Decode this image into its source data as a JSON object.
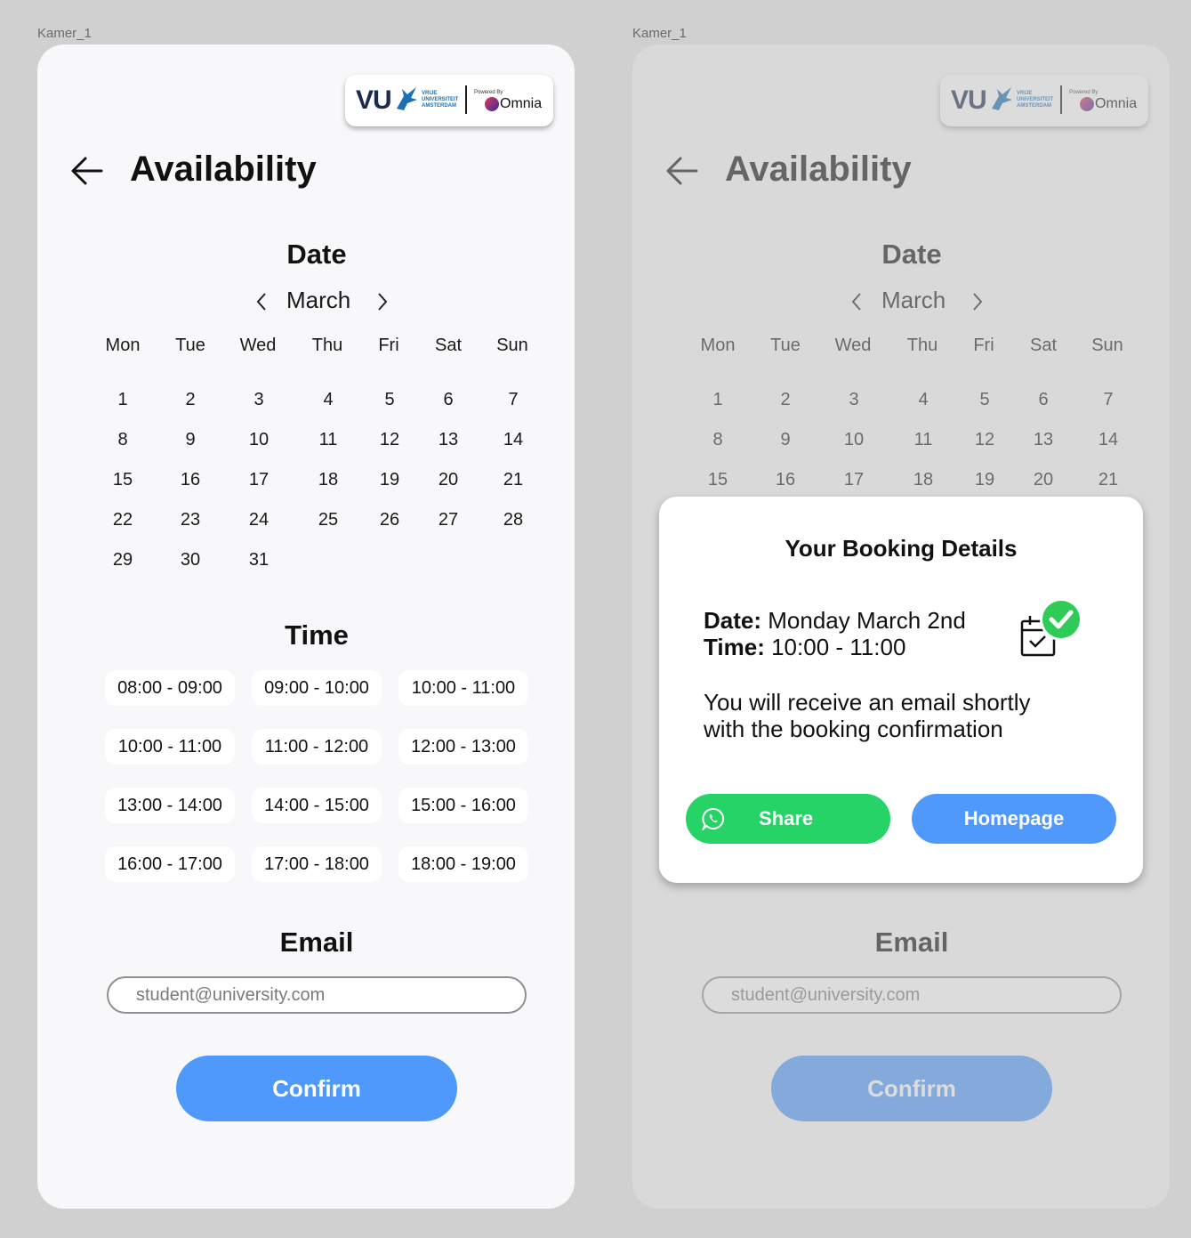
{
  "frame_label": "Kamer_1",
  "logo": {
    "vu": "VU",
    "uni_line1": "VRIJE",
    "uni_line2": "UNIVERSITEIT",
    "uni_line3": "AMSTERDAM",
    "powered": "Powered By",
    "omnia": "Omnia"
  },
  "title": "Availability",
  "date_section": {
    "title": "Date",
    "month": "March",
    "weekdays": [
      "Mon",
      "Tue",
      "Wed",
      "Thu",
      "Fri",
      "Sat",
      "Sun"
    ],
    "days": [
      1,
      2,
      3,
      4,
      5,
      6,
      7,
      8,
      9,
      10,
      11,
      12,
      13,
      14,
      15,
      16,
      17,
      18,
      19,
      20,
      21,
      22,
      23,
      24,
      25,
      26,
      27,
      28,
      29,
      30,
      31
    ]
  },
  "time_section": {
    "title": "Time",
    "slots": [
      "08:00 - 09:00",
      "09:00 - 10:00",
      "10:00 - 11:00",
      "10:00 - 11:00",
      "11:00 - 12:00",
      "12:00 - 13:00",
      "13:00 - 14:00",
      "14:00 - 15:00",
      "15:00 - 16:00",
      "16:00 - 17:00",
      "17:00 - 18:00",
      "18:00 - 19:00"
    ]
  },
  "email_section": {
    "title": "Email",
    "placeholder": "student@university.com",
    "value": ""
  },
  "confirm_label": "Confirm",
  "modal": {
    "title": "Your Booking Details",
    "date_label": "Date:",
    "date_value": " Monday March 2nd",
    "time_label": "Time:",
    "time_value": " 10:00 - 11:00",
    "message_line1": "You will receive an email shortly",
    "message_line2": "with the booking confirmation",
    "share_label": "Share",
    "home_label": "Homepage"
  },
  "colors": {
    "accent_blue": "#4f98fc",
    "whatsapp_green": "#25d366",
    "check_green": "#2ecc57"
  },
  "icons": [
    "back-arrow-icon",
    "chevron-left-icon",
    "chevron-right-icon",
    "calendar-check-icon",
    "whatsapp-icon"
  ]
}
